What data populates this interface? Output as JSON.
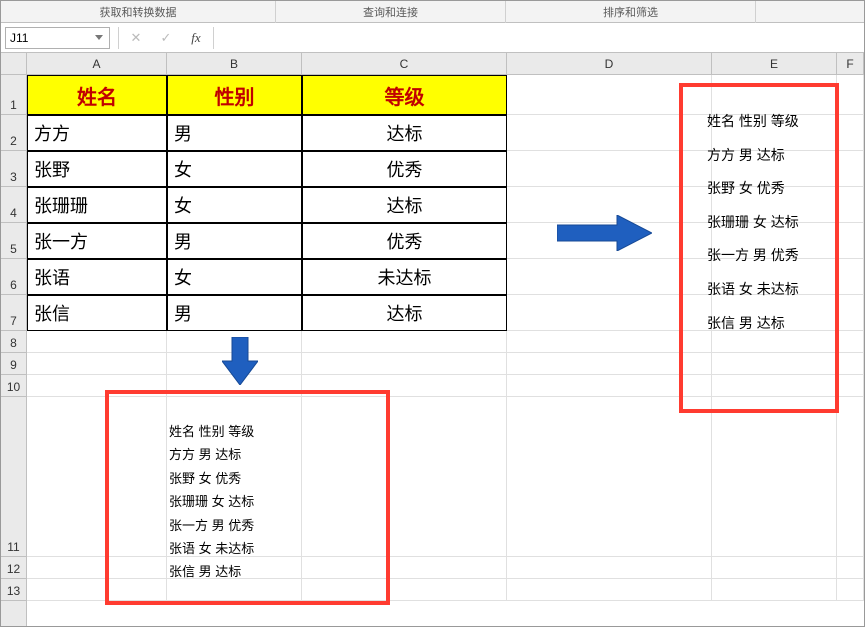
{
  "ribbon": {
    "group1": "获取和转换数据",
    "group2": "查询和连接",
    "group3": "排序和筛选"
  },
  "formula_bar": {
    "cell_ref": "J11",
    "formula": ""
  },
  "columns": [
    "A",
    "B",
    "C",
    "D",
    "E",
    "F"
  ],
  "row_numbers": [
    "1",
    "2",
    "3",
    "4",
    "5",
    "6",
    "7",
    "8",
    "9",
    "10",
    "11",
    "12",
    "13"
  ],
  "table": {
    "headers": {
      "A": "姓名",
      "B": "性别",
      "C": "等级"
    },
    "rows": [
      {
        "A": "方方",
        "B": "男",
        "C": "达标"
      },
      {
        "A": "张野",
        "B": "女",
        "C": "优秀"
      },
      {
        "A": "张珊珊",
        "B": "女",
        "C": "达标"
      },
      {
        "A": "张一方",
        "B": "男",
        "C": "优秀"
      },
      {
        "A": "张语",
        "B": "女",
        "C": "未达标"
      },
      {
        "A": "张信",
        "B": "男",
        "C": "达标"
      }
    ]
  },
  "concat_results": [
    "姓名 性别 等级",
    "方方 男 达标",
    "张野 女 优秀",
    "张珊珊 女 达标",
    "张一方 男 优秀",
    "张语 女 未达标",
    "张信 男 达标"
  ],
  "chart_data": {
    "type": "table",
    "columns": [
      "姓名",
      "性别",
      "等级"
    ],
    "rows": [
      [
        "方方",
        "男",
        "达标"
      ],
      [
        "张野",
        "女",
        "优秀"
      ],
      [
        "张珊珊",
        "女",
        "达标"
      ],
      [
        "张一方",
        "男",
        "优秀"
      ],
      [
        "张语",
        "女",
        "未达标"
      ],
      [
        "张信",
        "男",
        "达标"
      ]
    ]
  }
}
